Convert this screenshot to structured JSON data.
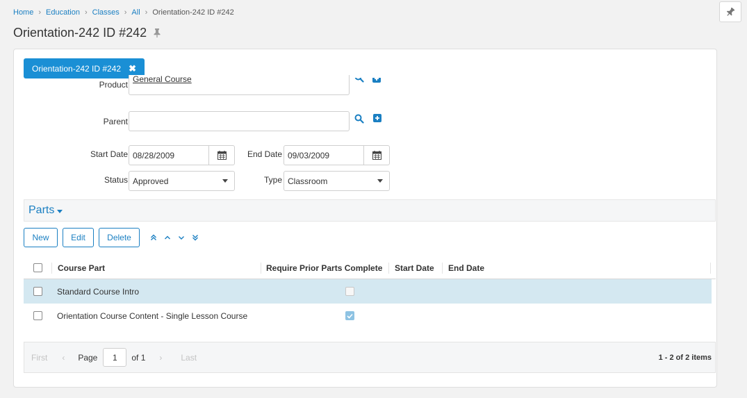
{
  "breadcrumb": {
    "items": [
      "Home",
      "Education",
      "Classes",
      "All"
    ],
    "current": "Orientation-242 ID #242"
  },
  "page": {
    "title": "Orientation-242 ID #242"
  },
  "tab": {
    "label": "Orientation-242 ID #242"
  },
  "form": {
    "product": {
      "label": "Product",
      "value": "General Course"
    },
    "parent": {
      "label": "Parent",
      "value": ""
    },
    "start_date": {
      "label": "Start Date",
      "value": "08/28/2009"
    },
    "end_date": {
      "label": "End Date",
      "value": "09/03/2009"
    },
    "status": {
      "label": "Status",
      "value": "Approved"
    },
    "type": {
      "label": "Type",
      "value": "Classroom"
    }
  },
  "parts": {
    "title": "Parts",
    "buttons": {
      "new": "New",
      "edit": "Edit",
      "delete": "Delete"
    },
    "columns": [
      "Course Part",
      "Require Prior Parts Complete",
      "Start Date",
      "End Date"
    ],
    "rows": [
      {
        "course_part": "Standard Course Intro",
        "require_prior": false,
        "start_date": "",
        "end_date": ""
      },
      {
        "course_part": "Orientation Course Content - Single Lesson Course",
        "require_prior": true,
        "start_date": "",
        "end_date": ""
      }
    ],
    "pager": {
      "first": "First",
      "page_label": "Page",
      "page": "1",
      "of_label": "of 1",
      "last": "Last",
      "summary": "1 - 2 of 2 items"
    }
  },
  "colors": {
    "accent": "#1a8fd5",
    "link": "#1a7fc2",
    "selected_row": "#d4e8f1"
  },
  "icons": [
    "pin-icon",
    "close-icon",
    "search-icon",
    "plus-square-icon",
    "calendar-icon",
    "chevron-down-icon",
    "move-top-icon",
    "move-up-icon",
    "move-down-icon",
    "move-bottom-icon",
    "chevron-left-icon",
    "chevron-right-icon",
    "check-icon"
  ]
}
